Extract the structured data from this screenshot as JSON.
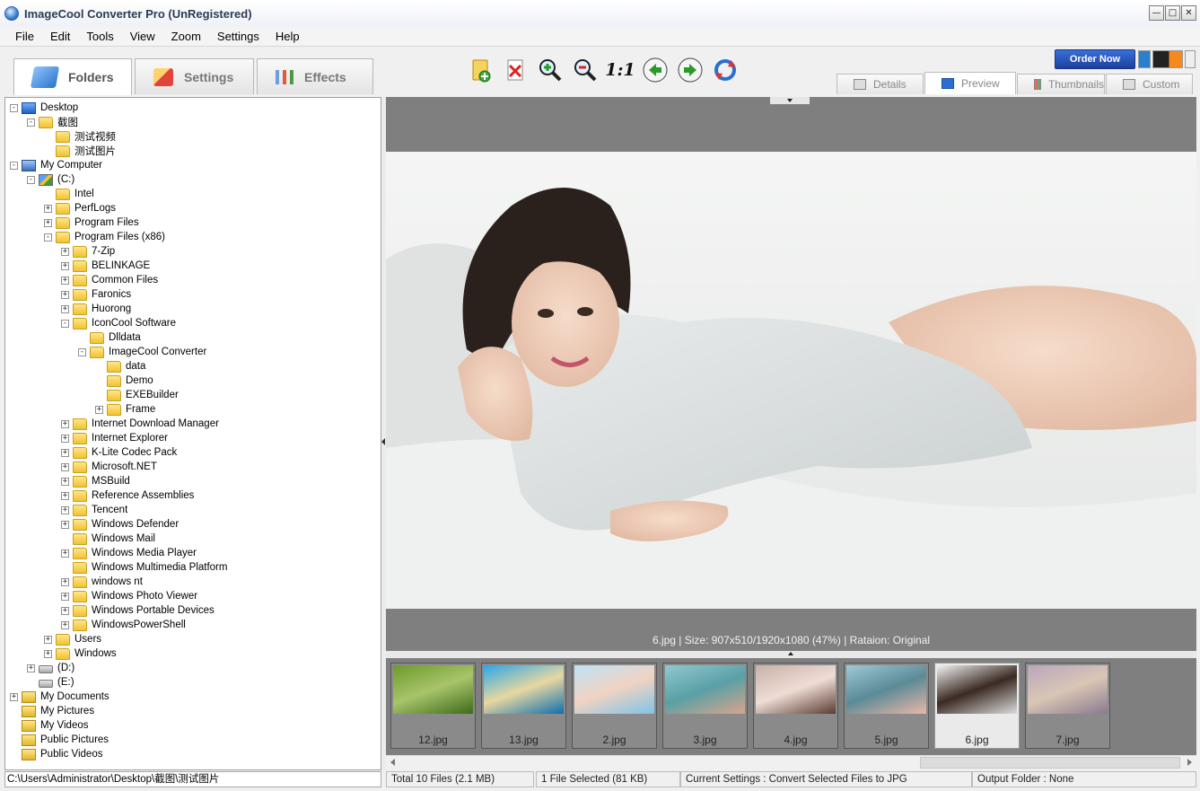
{
  "window": {
    "title": "ImageCool Converter Pro  (UnRegistered)",
    "minimize": "0",
    "maximize": "1",
    "close": "r"
  },
  "menu": [
    "File",
    "Edit",
    "Tools",
    "View",
    "Zoom",
    "Settings",
    "Help"
  ],
  "main_tabs": [
    {
      "label": "Folders",
      "icon": "folder-icon",
      "active": true
    },
    {
      "label": "Settings",
      "icon": "settings-icon",
      "active": false
    },
    {
      "label": "Effects",
      "icon": "effects-icon",
      "active": false
    }
  ],
  "toolbar": [
    {
      "name": "add-folder-button",
      "icon": "add-folder-icon"
    },
    {
      "name": "remove-file-button",
      "icon": "delete-icon"
    },
    {
      "name": "zoom-in-button",
      "icon": "zoom-in-icon"
    },
    {
      "name": "zoom-out-button",
      "icon": "zoom-out-icon"
    },
    {
      "name": "actual-size-button",
      "icon": "actual-size-icon",
      "label": "1:1"
    },
    {
      "name": "previous-button",
      "icon": "arrow-left-icon"
    },
    {
      "name": "next-button",
      "icon": "arrow-right-icon"
    },
    {
      "name": "rotate-button",
      "icon": "rotate-icon"
    }
  ],
  "order_button": "Order Now",
  "view_tabs": [
    {
      "label": "Details",
      "active": false
    },
    {
      "label": "Preview",
      "active": true
    },
    {
      "label": "Thumbnails",
      "active": false
    },
    {
      "label": "Custom",
      "active": false
    }
  ],
  "tree": [
    {
      "label": "Desktop",
      "depth": 0,
      "exp": "-",
      "icon": "desktop"
    },
    {
      "label": "截图",
      "depth": 1,
      "exp": "-",
      "icon": "folder"
    },
    {
      "label": "测试视频",
      "depth": 2,
      "exp": "",
      "icon": "folder"
    },
    {
      "label": "测试图片",
      "depth": 2,
      "exp": "",
      "icon": "folder"
    },
    {
      "label": "My Computer",
      "depth": 0,
      "exp": "-",
      "icon": "computer"
    },
    {
      "label": "(C:)",
      "depth": 1,
      "exp": "-",
      "icon": "cdrive"
    },
    {
      "label": "Intel",
      "depth": 2,
      "exp": "",
      "icon": "folder"
    },
    {
      "label": "PerfLogs",
      "depth": 2,
      "exp": "+",
      "icon": "folder"
    },
    {
      "label": "Program Files",
      "depth": 2,
      "exp": "+",
      "icon": "folder"
    },
    {
      "label": "Program Files (x86)",
      "depth": 2,
      "exp": "-",
      "icon": "folder"
    },
    {
      "label": "7-Zip",
      "depth": 3,
      "exp": "+",
      "icon": "folder"
    },
    {
      "label": "BELINKAGE",
      "depth": 3,
      "exp": "+",
      "icon": "folder"
    },
    {
      "label": "Common Files",
      "depth": 3,
      "exp": "+",
      "icon": "folder"
    },
    {
      "label": "Faronics",
      "depth": 3,
      "exp": "+",
      "icon": "folder"
    },
    {
      "label": "Huorong",
      "depth": 3,
      "exp": "+",
      "icon": "folder"
    },
    {
      "label": "IconCool Software",
      "depth": 3,
      "exp": "-",
      "icon": "folder"
    },
    {
      "label": "Dlldata",
      "depth": 4,
      "exp": "",
      "icon": "folder"
    },
    {
      "label": "ImageCool Converter",
      "depth": 4,
      "exp": "-",
      "icon": "folder"
    },
    {
      "label": "data",
      "depth": 5,
      "exp": "",
      "icon": "folder"
    },
    {
      "label": "Demo",
      "depth": 5,
      "exp": "",
      "icon": "folder"
    },
    {
      "label": "EXEBuilder",
      "depth": 5,
      "exp": "",
      "icon": "folder"
    },
    {
      "label": "Frame",
      "depth": 5,
      "exp": "+",
      "icon": "folder"
    },
    {
      "label": "Internet Download Manager",
      "depth": 3,
      "exp": "+",
      "icon": "folder"
    },
    {
      "label": "Internet Explorer",
      "depth": 3,
      "exp": "+",
      "icon": "folder"
    },
    {
      "label": "K-Lite Codec Pack",
      "depth": 3,
      "exp": "+",
      "icon": "folder"
    },
    {
      "label": "Microsoft.NET",
      "depth": 3,
      "exp": "+",
      "icon": "folder"
    },
    {
      "label": "MSBuild",
      "depth": 3,
      "exp": "+",
      "icon": "folder"
    },
    {
      "label": "Reference Assemblies",
      "depth": 3,
      "exp": "+",
      "icon": "folder"
    },
    {
      "label": "Tencent",
      "depth": 3,
      "exp": "+",
      "icon": "folder"
    },
    {
      "label": "Windows Defender",
      "depth": 3,
      "exp": "+",
      "icon": "folder"
    },
    {
      "label": "Windows Mail",
      "depth": 3,
      "exp": "",
      "icon": "folder"
    },
    {
      "label": "Windows Media Player",
      "depth": 3,
      "exp": "+",
      "icon": "folder"
    },
    {
      "label": "Windows Multimedia Platform",
      "depth": 3,
      "exp": "",
      "icon": "folder"
    },
    {
      "label": "windows nt",
      "depth": 3,
      "exp": "+",
      "icon": "folder"
    },
    {
      "label": "Windows Photo Viewer",
      "depth": 3,
      "exp": "+",
      "icon": "folder"
    },
    {
      "label": "Windows Portable Devices",
      "depth": 3,
      "exp": "+",
      "icon": "folder"
    },
    {
      "label": "WindowsPowerShell",
      "depth": 3,
      "exp": "+",
      "icon": "folder"
    },
    {
      "label": "Users",
      "depth": 2,
      "exp": "+",
      "icon": "folder"
    },
    {
      "label": "Windows",
      "depth": 2,
      "exp": "+",
      "icon": "folder"
    },
    {
      "label": "(D:)",
      "depth": 1,
      "exp": "+",
      "icon": "drive"
    },
    {
      "label": "(E:)",
      "depth": 1,
      "exp": "",
      "icon": "drive"
    },
    {
      "label": "My Documents",
      "depth": 0,
      "exp": "+",
      "icon": "doc"
    },
    {
      "label": "My Pictures",
      "depth": 0,
      "exp": "",
      "icon": "doc"
    },
    {
      "label": "My Videos",
      "depth": 0,
      "exp": "",
      "icon": "doc"
    },
    {
      "label": "Public Pictures",
      "depth": 0,
      "exp": "",
      "icon": "doc"
    },
    {
      "label": "Public Videos",
      "depth": 0,
      "exp": "",
      "icon": "doc"
    }
  ],
  "preview": {
    "caption": "6.jpg  |  Size: 907x510/1920x1080 (47%)  |  Rataion: Original"
  },
  "thumbnails": [
    {
      "label": "12.jpg",
      "selected": false,
      "palette": [
        "#6e9a2c",
        "#3d6a1a",
        "#a8c46a"
      ]
    },
    {
      "label": "13.jpg",
      "selected": false,
      "palette": [
        "#2aa7e8",
        "#0f6fb0",
        "#e8d7a0"
      ]
    },
    {
      "label": "2.jpg",
      "selected": false,
      "palette": [
        "#bfe3f6",
        "#7fc3e8",
        "#f1d3c2"
      ]
    },
    {
      "label": "3.jpg",
      "selected": false,
      "palette": [
        "#8fc9cf",
        "#d9a58a",
        "#5aa0a6"
      ]
    },
    {
      "label": "4.jpg",
      "selected": false,
      "palette": [
        "#c8b1a8",
        "#5a3b30",
        "#eeddd5"
      ]
    },
    {
      "label": "5.jpg",
      "selected": false,
      "palette": [
        "#9fc9d8",
        "#e9b7a6",
        "#5c8a96"
      ]
    },
    {
      "label": "6.jpg",
      "selected": true,
      "palette": [
        "#f2f2f2",
        "#dcdcdc",
        "#3a2a22"
      ]
    },
    {
      "label": "7.jpg",
      "selected": false,
      "palette": [
        "#b9a6bd",
        "#8a7a8f",
        "#d9c6b5"
      ]
    }
  ],
  "status": {
    "path": "C:\\Users\\Administrator\\Desktop\\截图\\测试图片",
    "total": "Total 10 Files (2.1 MB)",
    "selected": "1 File Selected (81 KB)",
    "settings": "Current Settings : Convert Selected Files to JPG",
    "output": "Output Folder : None"
  },
  "colors": {
    "accent": "#1d3f9e",
    "preview_bg": "#7f7f7f",
    "folder": "#f1c232"
  }
}
